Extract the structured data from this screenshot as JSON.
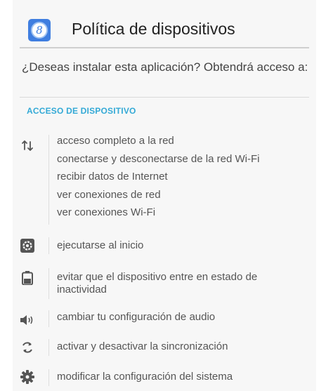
{
  "header": {
    "title": "Política de dispositivos",
    "app_icon": "google-device-policy-icon",
    "app_icon_glyph": "8",
    "accent": "#3f7ee0"
  },
  "prompt": "¿Deseas instalar esta aplicación? Obtendrá acceso a:",
  "section": {
    "title": "ACCESO DE DISPOSITIVO",
    "color": "#33a9d6"
  },
  "groups": [
    {
      "icon": "network-arrows-icon",
      "items": [
        "acceso completo a la red",
        "conectarse y desconectarse de la red Wi-Fi",
        "recibir datos de Internet",
        "ver conexiones de red",
        "ver conexiones Wi-Fi"
      ]
    },
    {
      "icon": "startup-gear-icon",
      "items": [
        "ejecutarse al inicio"
      ]
    },
    {
      "icon": "battery-icon",
      "items": [
        "evitar que el dispositivo entre en estado de inactividad"
      ]
    },
    {
      "icon": "speaker-icon",
      "items": [
        "cambiar tu configuración de audio"
      ]
    },
    {
      "icon": "sync-icon",
      "items": [
        "activar y desactivar la sincronización"
      ]
    },
    {
      "icon": "settings-gear-icon",
      "items": [
        "modificar la configuración del sistema"
      ]
    }
  ]
}
